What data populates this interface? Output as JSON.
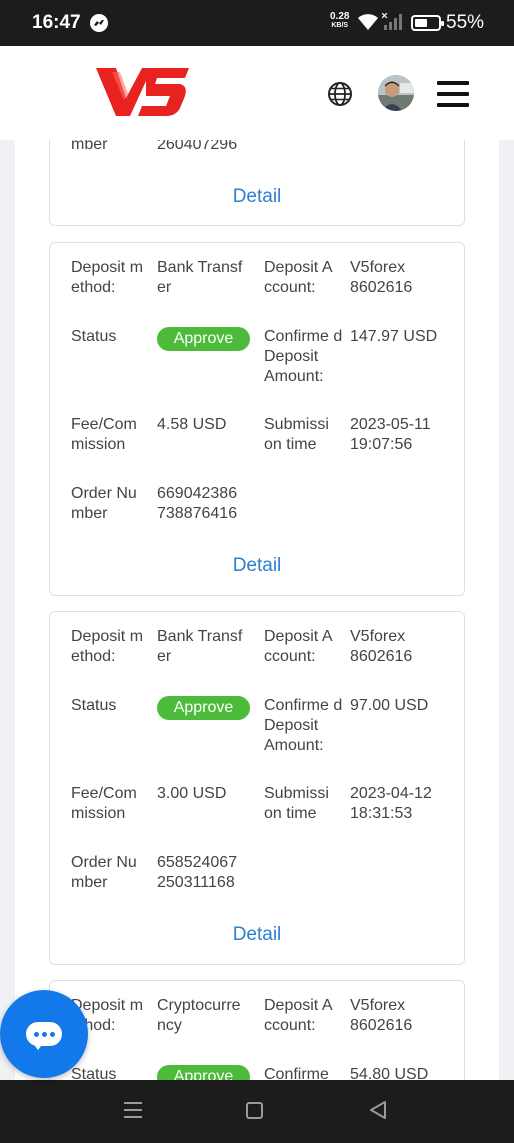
{
  "status_bar": {
    "time": "16:47",
    "speed_value": "0.28",
    "speed_unit": "KB/S",
    "battery": "55%",
    "icons": [
      "messenger-icon",
      "wifi-icon",
      "signal-icon",
      "battery-icon"
    ]
  },
  "header": {
    "logo_text": "V5",
    "icons": [
      "globe-icon",
      "avatar",
      "menu-icon"
    ],
    "brand_color": "#e8231f"
  },
  "partial_top_card": {
    "label": "mber",
    "value": "260407296",
    "detail": "Detail"
  },
  "cards": [
    {
      "method_label": "Deposit m ethod:",
      "method_value": "Bank Transf er",
      "account_label": "Deposit A ccount:",
      "account_value": "V5forex 8602616",
      "status_label": "Status",
      "status_value": "Approve",
      "confirmed_label": "Confirme d Deposit Amount:",
      "confirmed_value": "147.97 USD",
      "fee_label": "Fee/Com mission",
      "fee_value": "4.58 USD",
      "time_label": "Submissi on time",
      "time_value": "2023-05-11 19:07:56",
      "order_label": "Order Nu mber",
      "order_value": "669042386 738876416",
      "detail": "Detail"
    },
    {
      "method_label": "Deposit m ethod:",
      "method_value": "Bank Transf er",
      "account_label": "Deposit A ccount:",
      "account_value": "V5forex 8602616",
      "status_label": "Status",
      "status_value": "Approve",
      "confirmed_label": "Confirme d Deposit Amount:",
      "confirmed_value": "97.00 USD",
      "fee_label": "Fee/Com mission",
      "fee_value": "3.00 USD",
      "time_label": "Submissi on time",
      "time_value": "2023-04-12 18:31:53",
      "order_label": "Order Nu mber",
      "order_value": "658524067 250311168",
      "detail": "Detail"
    },
    {
      "method_label": "Deposit m ethod:",
      "method_value": "Cryptocurre ncy",
      "account_label": "Deposit A ccount:",
      "account_value": "V5forex 8602616",
      "status_label": "Status",
      "status_value": "Approve",
      "confirmed_label": "Confirme",
      "confirmed_value": "54.80 USD"
    }
  ],
  "colors": {
    "approve_badge": "#4cbb3a",
    "detail_link": "#2f7fd0",
    "chat_button": "#1379ea"
  },
  "nav_bar": {
    "icons": [
      "recent-apps-icon",
      "home-icon",
      "back-icon"
    ]
  }
}
